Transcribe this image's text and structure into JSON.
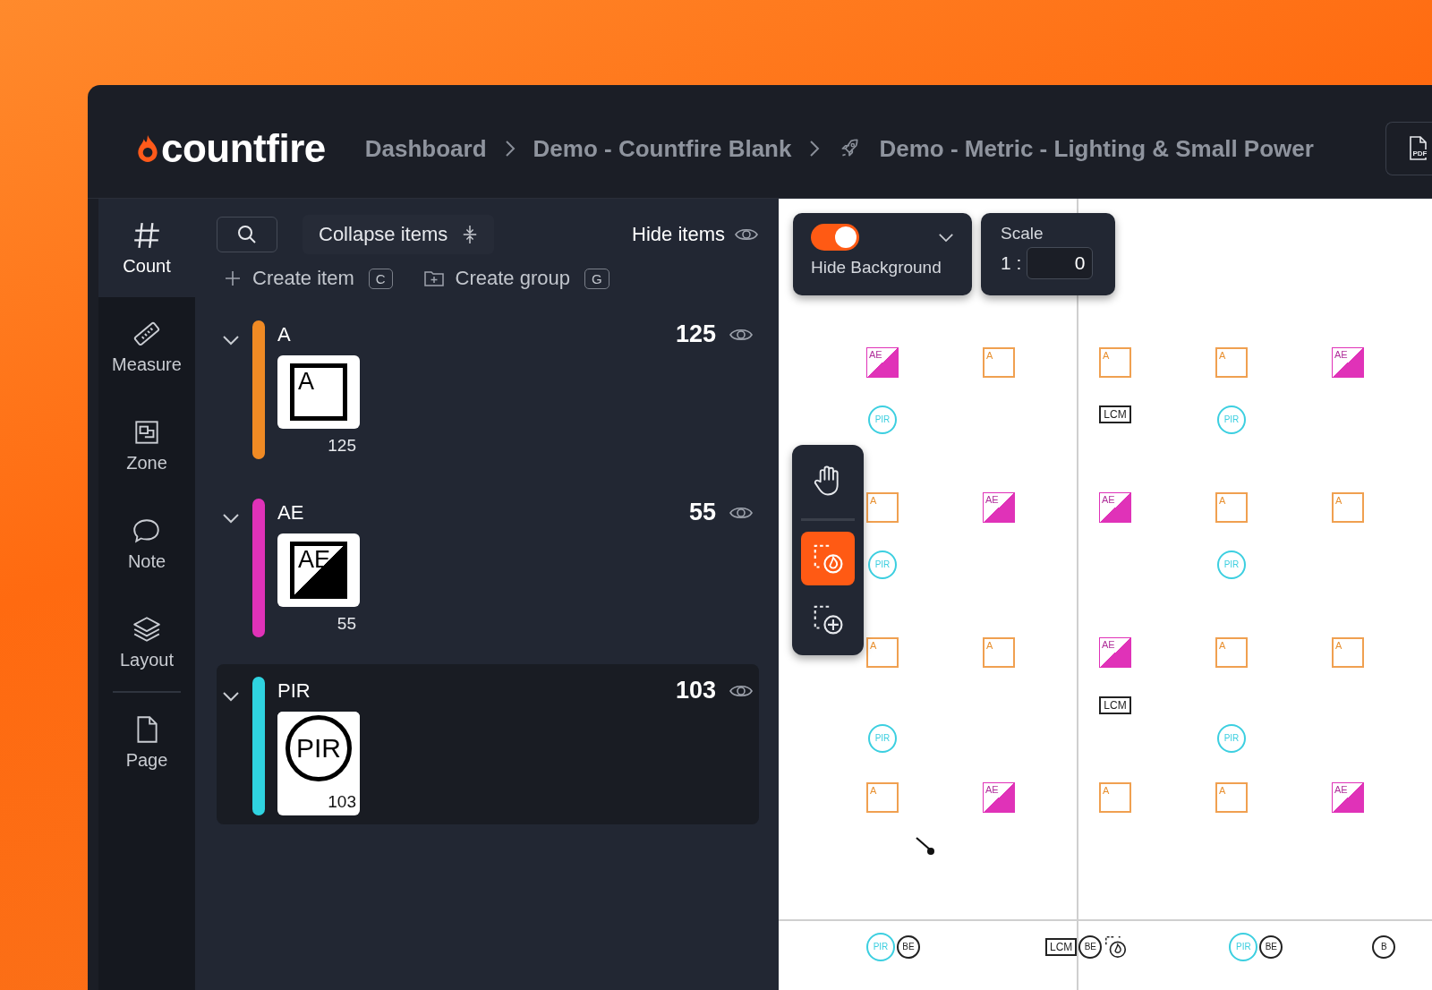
{
  "logo": {
    "text": "countfire"
  },
  "breadcrumbs": [
    {
      "label": "Dashboard",
      "kind": "link"
    },
    {
      "label": "Demo - Countfire Blank",
      "kind": "link"
    },
    {
      "label": "Demo - Metric - Lighting & Small Power",
      "kind": "project"
    }
  ],
  "pdf_button": {
    "label": "PDF"
  },
  "rail": [
    {
      "label": "Count",
      "kind": "hash",
      "selected": true
    },
    {
      "label": "Measure",
      "kind": "ruler",
      "selected": false
    },
    {
      "label": "Zone",
      "kind": "zone",
      "selected": false
    },
    {
      "label": "Note",
      "kind": "note",
      "selected": false
    },
    {
      "label": "Layout",
      "kind": "layers",
      "selected": false
    },
    {
      "label": "Page",
      "kind": "page",
      "selected": false
    }
  ],
  "toolbar": {
    "collapse": "Collapse items",
    "hide": "Hide items"
  },
  "actions": [
    {
      "label": "Create item",
      "shortcut": "C",
      "kind": "item"
    },
    {
      "label": "Create group",
      "shortcut": "G",
      "kind": "group"
    }
  ],
  "groups": [
    {
      "name": "A",
      "count": "125",
      "thumb_count": "125",
      "symbol": "A",
      "kind": "square",
      "color": "#f08a24",
      "expanded": true,
      "selected": false
    },
    {
      "name": "AE",
      "count": "55",
      "thumb_count": "55",
      "symbol": "AE",
      "kind": "split",
      "color": "#e032b8",
      "expanded": true,
      "selected": false
    },
    {
      "name": "PIR",
      "count": "103",
      "thumb_count": "103",
      "symbol": "PIR",
      "kind": "circle",
      "color": "#2fd3e0",
      "expanded": true,
      "selected": true
    }
  ],
  "canvas_controls": {
    "hide_background": true,
    "toggle_label": "Hide Background",
    "scale_label": "Scale",
    "scale_prefix": "1 :",
    "scale_value": "0"
  },
  "tools": [
    {
      "kind": "pan",
      "selected": false
    },
    {
      "kind": "count",
      "selected": true
    },
    {
      "kind": "add_zone",
      "selected": false
    }
  ],
  "markers": [
    [
      {
        "kind": "split",
        "label": "AE"
      },
      {
        "kind": "square",
        "label": "A"
      },
      {
        "kind": "square",
        "label": "A"
      },
      {
        "kind": "square",
        "label": "A"
      },
      {
        "kind": "split",
        "label": "AE"
      }
    ],
    [
      {
        "kind": "circle",
        "label": "PIR"
      },
      {
        "kind": "blank"
      },
      {
        "kind": "rect",
        "label": "LCM"
      },
      {
        "kind": "circle",
        "label": "PIR"
      },
      {
        "kind": "blank"
      }
    ],
    [
      {
        "kind": "square",
        "label": "A"
      },
      {
        "kind": "split",
        "label": "AE"
      },
      {
        "kind": "split",
        "label": "AE"
      },
      {
        "kind": "square",
        "label": "A"
      },
      {
        "kind": "square",
        "label": "A"
      }
    ],
    [
      {
        "kind": "circle",
        "label": "PIR"
      },
      {
        "kind": "blank"
      },
      {
        "kind": "blank"
      },
      {
        "kind": "circle",
        "label": "PIR"
      },
      {
        "kind": "blank"
      }
    ],
    [
      {
        "kind": "square",
        "label": "A"
      },
      {
        "kind": "square",
        "label": "A"
      },
      {
        "kind": "split",
        "label": "AE"
      },
      {
        "kind": "square",
        "label": "A"
      },
      {
        "kind": "square",
        "label": "A"
      }
    ],
    [
      {
        "kind": "blank"
      },
      {
        "kind": "blank"
      },
      {
        "kind": "rect",
        "label": "LCM"
      },
      {
        "kind": "blank"
      },
      {
        "kind": "blank"
      }
    ],
    [
      {
        "kind": "circle",
        "label": "PIR"
      },
      {
        "kind": "blank"
      },
      {
        "kind": "blank"
      },
      {
        "kind": "circle",
        "label": "PIR"
      },
      {
        "kind": "blank"
      }
    ],
    [
      {
        "kind": "square",
        "label": "A"
      },
      {
        "kind": "split",
        "label": "AE"
      },
      {
        "kind": "square",
        "label": "A"
      },
      {
        "kind": "square",
        "label": "A"
      },
      {
        "kind": "split",
        "label": "AE"
      }
    ]
  ],
  "bottom_marks": [
    [
      {
        "kind": "circle",
        "label": "PIR"
      },
      {
        "kind": "badge",
        "label": "BE"
      }
    ],
    [
      {
        "kind": "rect",
        "label": "LCM"
      },
      {
        "kind": "badge",
        "label": "BE"
      },
      {
        "kind": "fire"
      }
    ],
    [
      {
        "kind": "circle",
        "label": "PIR"
      },
      {
        "kind": "badge",
        "label": "BE"
      }
    ],
    [
      {
        "kind": "badge",
        "label": "B"
      }
    ]
  ]
}
